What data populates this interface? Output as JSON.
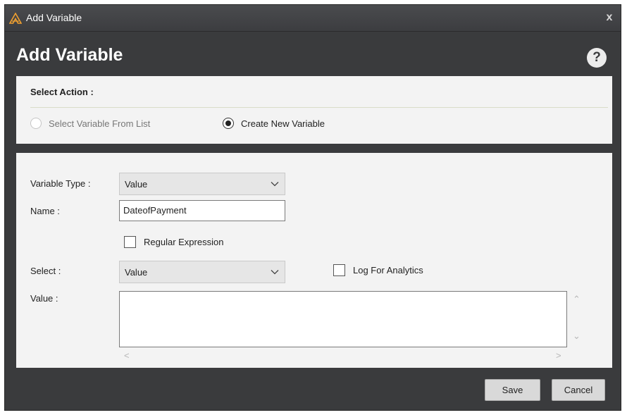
{
  "window": {
    "title": "Add Variable",
    "close_glyph": "x"
  },
  "header": {
    "title": "Add Variable",
    "help_glyph": "?"
  },
  "select_action": {
    "label": "Select Action :",
    "options": [
      {
        "label": "Select Variable From List",
        "selected": false,
        "enabled": false
      },
      {
        "label": "Create New Variable",
        "selected": true,
        "enabled": true
      }
    ]
  },
  "form": {
    "variable_type": {
      "label": "Variable Type :",
      "value": "Value"
    },
    "name": {
      "label": "Name :",
      "value": "DateofPayment"
    },
    "regular_expression": {
      "label": "Regular Expression",
      "checked": false
    },
    "select": {
      "label": "Select :",
      "value": "Value"
    },
    "log_for_analytics": {
      "label": "Log For Analytics",
      "checked": false
    },
    "value": {
      "label": "Value :",
      "text": ""
    }
  },
  "scroll_glyphs": {
    "up": "⌃",
    "down": "⌄",
    "left": "<",
    "right": ">"
  },
  "footer": {
    "save_label": "Save",
    "cancel_label": "Cancel"
  },
  "colors": {
    "window_bg": "#3a3b3d",
    "panel_bg": "#f3f3f3",
    "app_icon": "#f0a030"
  },
  "icons": {
    "app": "app-logo-icon",
    "close": "close-icon",
    "help": "help-icon",
    "dropdown": "chevron-down-icon"
  }
}
